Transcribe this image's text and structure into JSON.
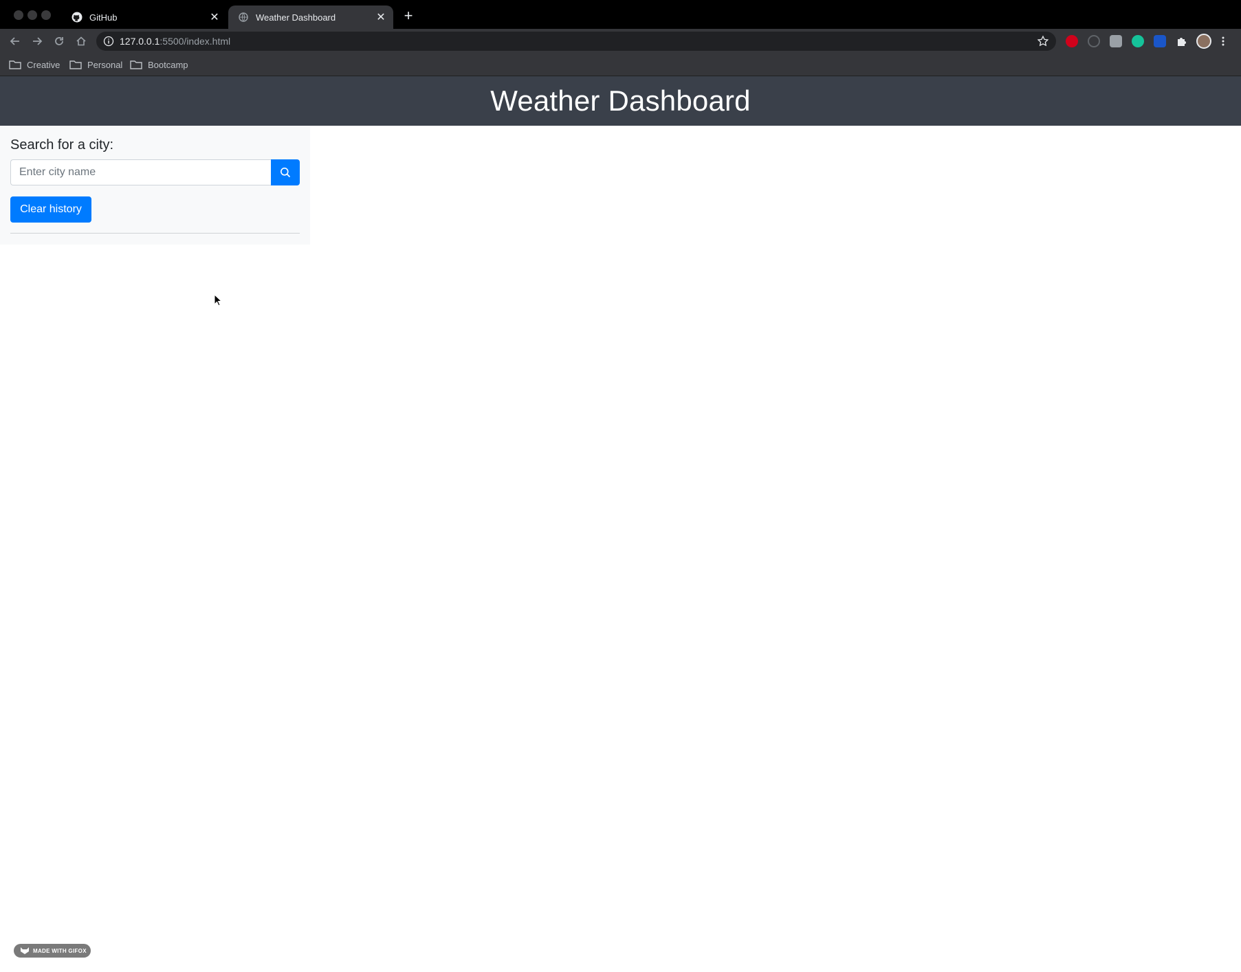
{
  "browser": {
    "tabs": [
      {
        "title": "GitHub",
        "favicon": "github-icon",
        "active": false
      },
      {
        "title": "Weather Dashboard",
        "favicon": "globe-icon",
        "active": true
      }
    ],
    "address_host": "127.0.0.1",
    "address_rest": ":5500/index.html",
    "bookmarks": [
      "Creative",
      "Personal",
      "Bootcamp"
    ]
  },
  "header": {
    "title": "Weather Dashboard"
  },
  "sidebar": {
    "search_label": "Search for a city:",
    "search_placeholder": "Enter city name",
    "clear_label": "Clear history"
  },
  "watermark": {
    "text": "MADE WITH GIFOX"
  },
  "colors": {
    "header_bg": "#3a404a",
    "primary": "#007bff",
    "sidebar_bg": "#f8f9fa"
  }
}
